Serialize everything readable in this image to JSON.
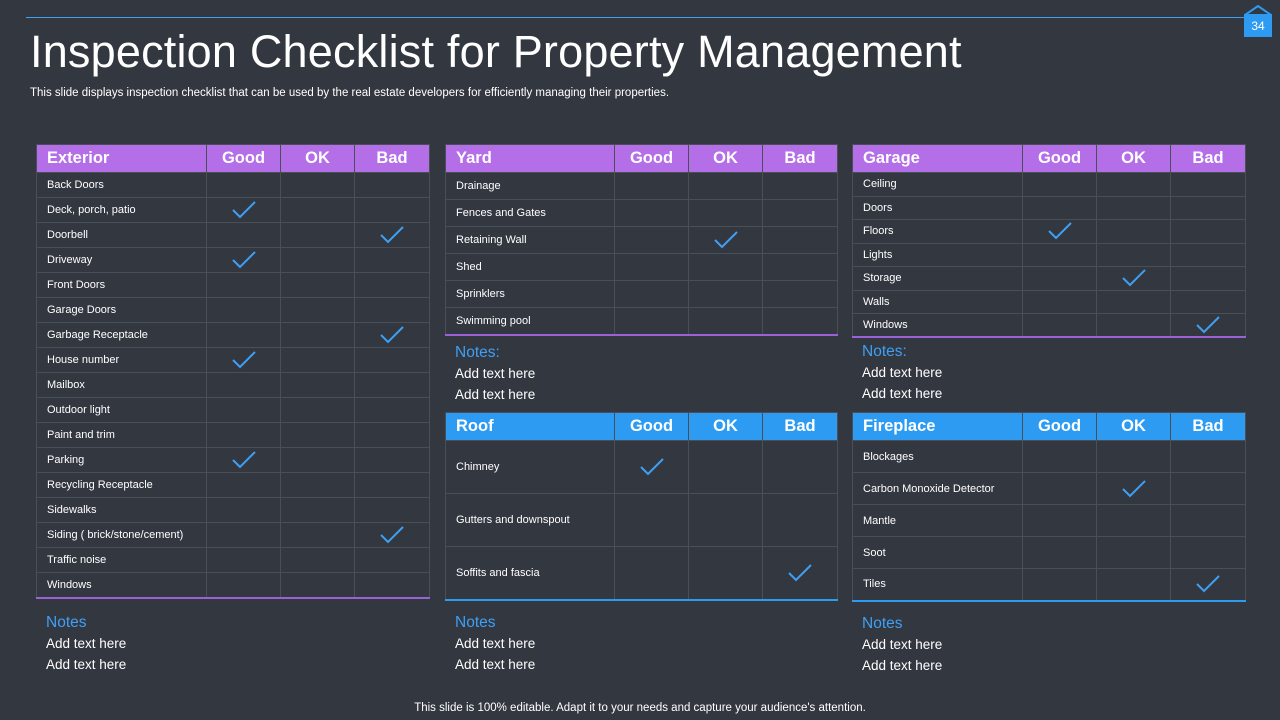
{
  "slide": {
    "page_number": "34",
    "title": "Inspection Checklist for Property Management",
    "subtitle": "This slide displays inspection checklist that can be used by the real estate developers for efficiently managing their properties.",
    "footer": "This slide is 100% editable. Adapt it to your needs and capture your audience's attention."
  },
  "colors": {
    "purple_header": "#b36ee8",
    "blue_header": "#2e9bf3",
    "check": "#3ea0f5",
    "background": "#333740"
  },
  "tables": {
    "exterior": {
      "headers": [
        "Exterior",
        "Good",
        "OK",
        "Bad"
      ],
      "rows": [
        {
          "label": "Back Doors",
          "rating": ""
        },
        {
          "label": "Deck, porch, patio",
          "rating": "Good"
        },
        {
          "label": "Doorbell",
          "rating": "Bad"
        },
        {
          "label": "Driveway",
          "rating": "Good"
        },
        {
          "label": "Front Doors",
          "rating": ""
        },
        {
          "label": "Garage Doors",
          "rating": ""
        },
        {
          "label": "Garbage Receptacle",
          "rating": "Bad"
        },
        {
          "label": "House number",
          "rating": "Good"
        },
        {
          "label": "Mailbox",
          "rating": ""
        },
        {
          "label": "Outdoor light",
          "rating": ""
        },
        {
          "label": "Paint and trim",
          "rating": ""
        },
        {
          "label": "Parking",
          "rating": "Good"
        },
        {
          "label": "Recycling Receptacle",
          "rating": ""
        },
        {
          "label": "Sidewalks",
          "rating": ""
        },
        {
          "label": "Siding ( brick/stone/cement)",
          "rating": "Bad"
        },
        {
          "label": "Traffic noise",
          "rating": ""
        },
        {
          "label": "Windows",
          "rating": ""
        }
      ]
    },
    "yard": {
      "headers": [
        "Yard",
        "Good",
        "OK",
        "Bad"
      ],
      "rows": [
        {
          "label": "Drainage",
          "rating": ""
        },
        {
          "label": "Fences and Gates",
          "rating": ""
        },
        {
          "label": "Retaining Wall",
          "rating": "OK"
        },
        {
          "label": "Shed",
          "rating": ""
        },
        {
          "label": "Sprinklers",
          "rating": ""
        },
        {
          "label": "Swimming pool",
          "rating": ""
        }
      ]
    },
    "garage": {
      "headers": [
        "Garage",
        "Good",
        "OK",
        "Bad"
      ],
      "rows": [
        {
          "label": "Ceiling",
          "rating": ""
        },
        {
          "label": "Doors",
          "rating": ""
        },
        {
          "label": "Floors",
          "rating": "Good"
        },
        {
          "label": "Lights",
          "rating": ""
        },
        {
          "label": "Storage",
          "rating": "OK"
        },
        {
          "label": "Walls",
          "rating": ""
        },
        {
          "label": "Windows",
          "rating": "Bad"
        }
      ]
    },
    "roof": {
      "headers": [
        "Roof",
        "Good",
        "OK",
        "Bad"
      ],
      "rows": [
        {
          "label": "Chimney",
          "rating": "Good"
        },
        {
          "label": "Gutters and downspout",
          "rating": ""
        },
        {
          "label": "Soffits and fascia",
          "rating": "Bad"
        }
      ]
    },
    "fireplace": {
      "headers": [
        "Fireplace",
        "Good",
        "OK",
        "Bad"
      ],
      "rows": [
        {
          "label": "Blockages",
          "rating": ""
        },
        {
          "label": "Carbon Monoxide Detector",
          "rating": "OK"
        },
        {
          "label": "Mantle",
          "rating": ""
        },
        {
          "label": "Soot",
          "rating": ""
        },
        {
          "label": "Tiles",
          "rating": "Bad"
        }
      ]
    }
  },
  "notes": {
    "exterior": {
      "heading": "Notes",
      "lines": [
        "Add text here",
        "Add text here"
      ]
    },
    "yard": {
      "heading": "Notes:",
      "lines": [
        "Add text here",
        "Add text here"
      ]
    },
    "garage": {
      "heading": "Notes:",
      "lines": [
        "Add text here",
        "Add text here"
      ]
    },
    "roof": {
      "heading": "Notes",
      "lines": [
        "Add text here",
        "Add text here"
      ]
    },
    "fireplace": {
      "heading": "Notes",
      "lines": [
        "Add text here",
        "Add text here"
      ]
    }
  }
}
